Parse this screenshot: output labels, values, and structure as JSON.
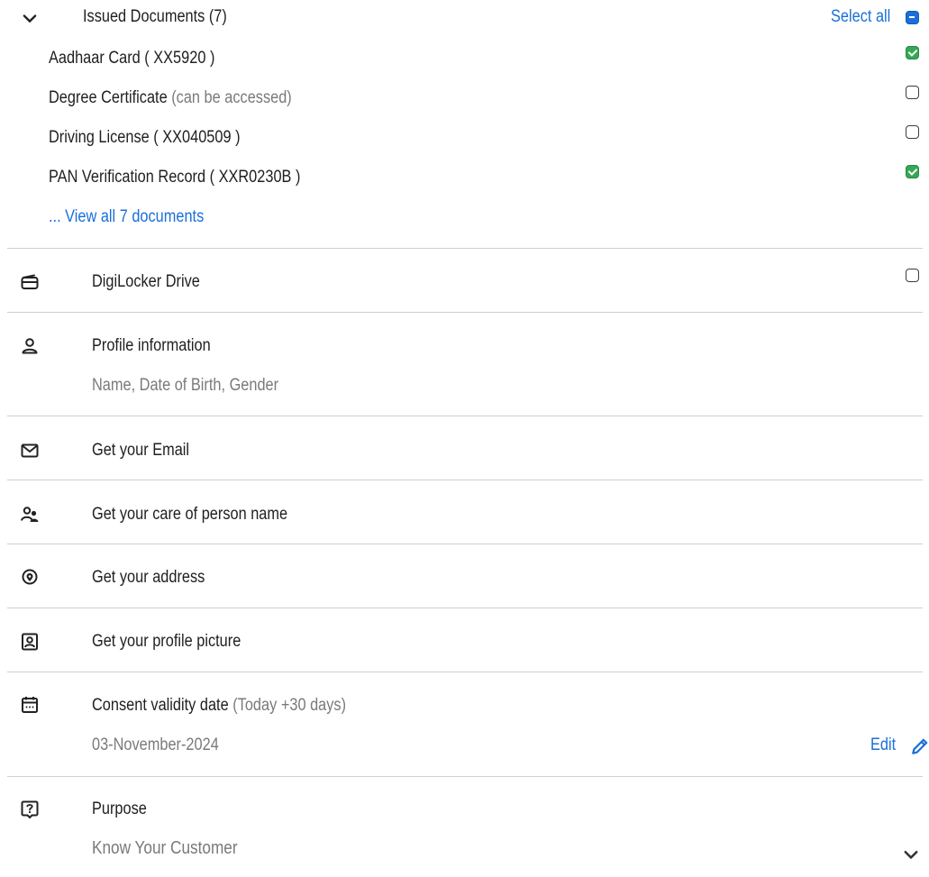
{
  "issued": {
    "title": "Issued Documents (7)",
    "select_all": "Select all",
    "documents": [
      {
        "name": "Aadhaar Card ( XX5920 )",
        "note": "",
        "checked": true
      },
      {
        "name": "Degree Certificate",
        "note": "(can be accessed)",
        "checked": false
      },
      {
        "name": "Driving License ( XX040509 )",
        "note": "",
        "checked": false
      },
      {
        "name": "PAN Verification Record ( XXR0230B )",
        "note": "",
        "checked": true
      }
    ],
    "view_all": "... View all 7 documents"
  },
  "drive": {
    "label": "DigiLocker Drive",
    "checked": false
  },
  "profile": {
    "label": "Profile information",
    "sub": "Name, Date of Birth, Gender"
  },
  "email": {
    "label": "Get your Email"
  },
  "care_of": {
    "label": "Get your care of person name"
  },
  "address": {
    "label": "Get your address"
  },
  "picture": {
    "label": "Get your profile picture"
  },
  "consent": {
    "label": "Consent validity date",
    "note": "(Today +30 days)",
    "date": "03-November-2024",
    "edit": "Edit"
  },
  "purpose": {
    "label": "Purpose",
    "value": "Know Your Customer"
  },
  "colors": {
    "accent": "#1a6fd8",
    "checked": "#34a853",
    "divider": "#d0d0d0",
    "muted": "#7a7a7a"
  }
}
